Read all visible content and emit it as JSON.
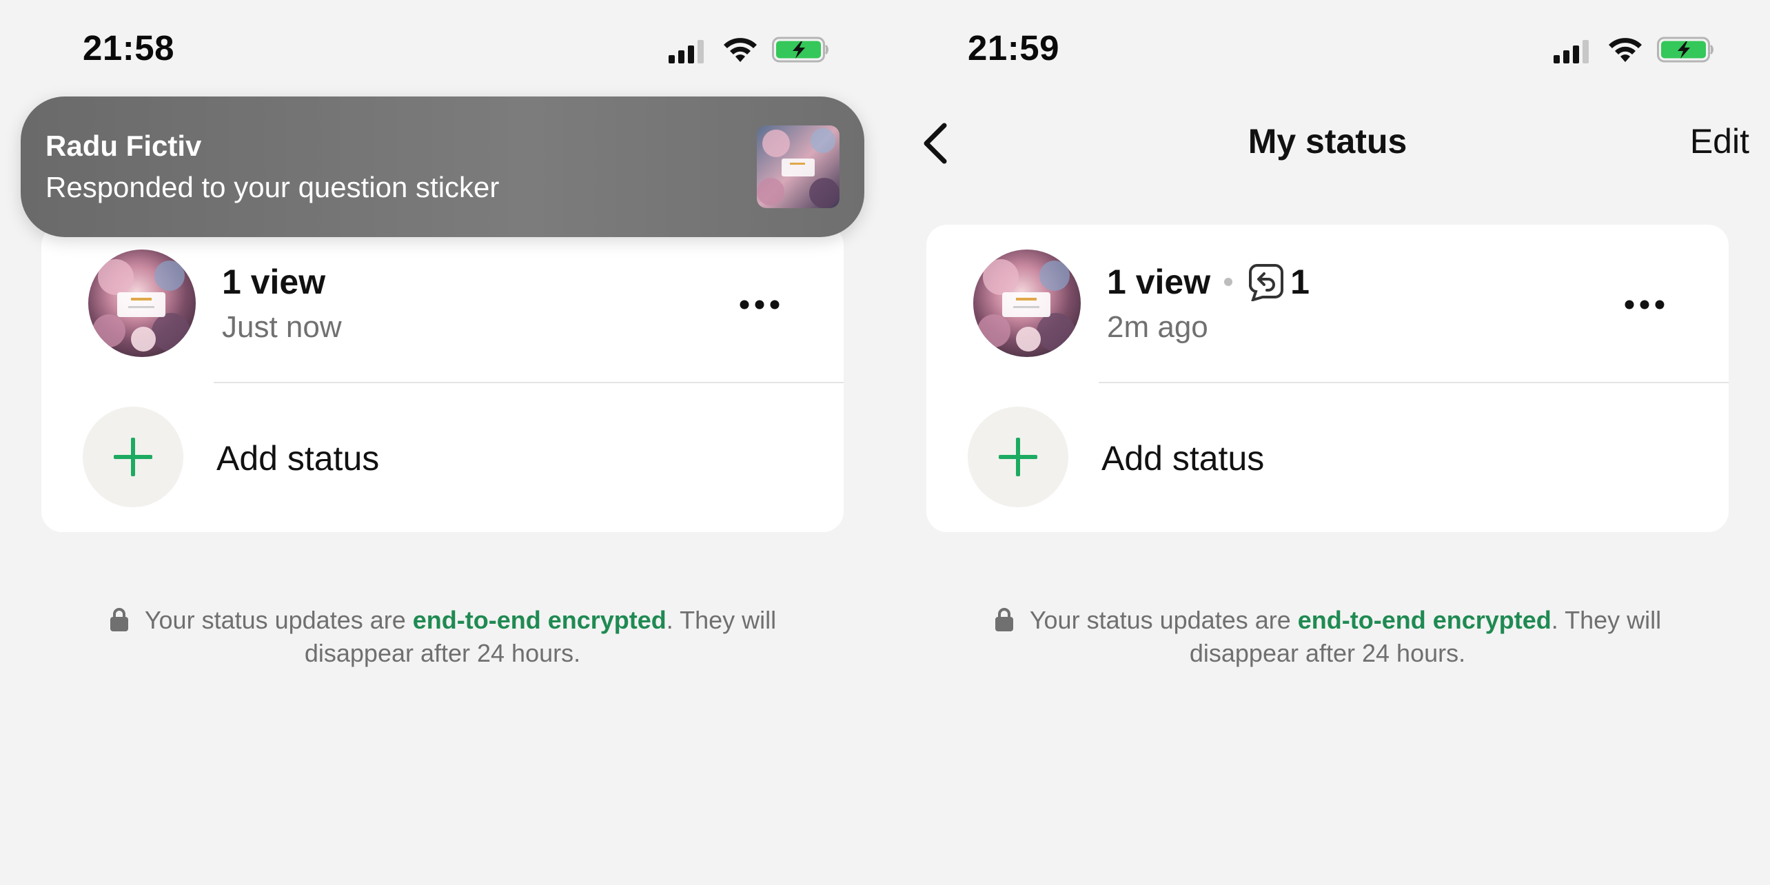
{
  "left": {
    "statusbar": {
      "time": "21:58"
    },
    "notification": {
      "title": "Radu Fictiv",
      "body": "Responded to your question sticker"
    },
    "status_row": {
      "views": "1 view",
      "time": "Just now"
    },
    "add_status": {
      "label": "Add status"
    },
    "footer": {
      "prefix": "Your status updates are ",
      "link": "end-to-end encrypted",
      "suffix": ". They will disappear after 24 hours."
    }
  },
  "right": {
    "statusbar": {
      "time": "21:59"
    },
    "nav": {
      "title": "My status",
      "edit": "Edit"
    },
    "status_row": {
      "views": "1 view",
      "replies": "1",
      "time": "2m ago"
    },
    "add_status": {
      "label": "Add status"
    },
    "footer": {
      "prefix": "Your status updates are ",
      "link": "end-to-end encrypted",
      "suffix": ". They will disappear after 24 hours."
    }
  },
  "colors": {
    "accent_green": "#1f8a52",
    "plus_green": "#1daa61",
    "battery_green": "#34c759",
    "background": "#f3f3f3"
  },
  "icons": [
    "signal-icon",
    "wifi-icon",
    "battery-charging-icon",
    "back-chevron-icon",
    "more-dots-icon",
    "plus-icon",
    "reply-icon",
    "lock-icon"
  ]
}
